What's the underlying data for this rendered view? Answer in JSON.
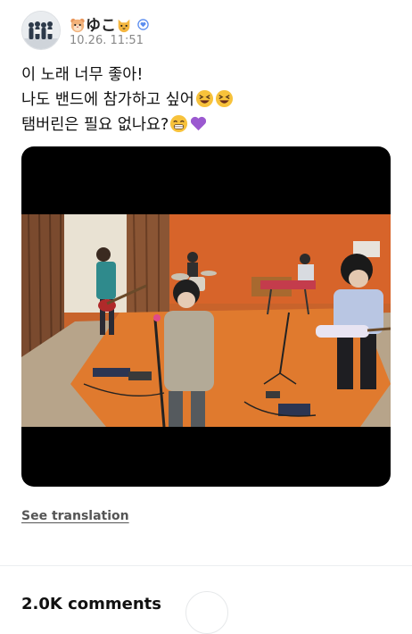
{
  "post": {
    "author_name": "ゆこ",
    "author_emoji_left": "hamster-face",
    "author_emoji_right": "cat-face",
    "verified_icon": "verified-heart-badge",
    "timestamp": "10.26. 11:51",
    "lines": [
      "이 노래 너무 좋아!",
      "나도 밴드에 참가하고 싶어",
      "탬버린은 필요 없나요?"
    ],
    "line2_emojis": [
      "grinning-squinting-face",
      "grinning-squinting-face"
    ],
    "line3_emojis": [
      "beaming-face-with-smiling-eyes",
      "purple-heart"
    ],
    "media_description_icon": "band-performance-video"
  },
  "actions": {
    "see_translation": "See translation"
  },
  "comments": {
    "count_label": "2.0K comments"
  },
  "colors": {
    "verified": "#5b8def",
    "purple_heart": "#9b59d0",
    "emoji_yellow": "#f7c23b",
    "room_orange": "#d7642a",
    "rug_orange": "#e07a2e"
  }
}
